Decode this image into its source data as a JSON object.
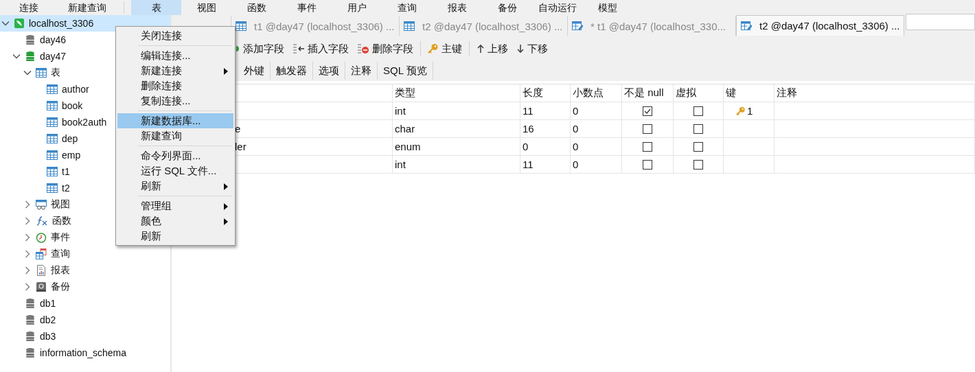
{
  "toolbar": [
    {
      "label": "连接",
      "selected": false
    },
    {
      "label": "新建查询",
      "selected": false
    },
    {
      "label": "表",
      "selected": true
    },
    {
      "label": "视图",
      "selected": false
    },
    {
      "label": "函数",
      "selected": false
    },
    {
      "label": "事件",
      "selected": false
    },
    {
      "label": "用户",
      "selected": false
    },
    {
      "label": "查询",
      "selected": false
    },
    {
      "label": "报表",
      "selected": false
    },
    {
      "label": "备份",
      "selected": false
    },
    {
      "label": "自动运行",
      "selected": false
    },
    {
      "label": "模型",
      "selected": false
    }
  ],
  "tree": [
    {
      "label": "localhost_3306",
      "kind": "connection",
      "expanded": true,
      "selected": true,
      "children": [
        {
          "label": "day46",
          "kind": "database",
          "open": false,
          "selected": false
        },
        {
          "label": "day47",
          "kind": "database",
          "open": true,
          "expanded": true,
          "selected": false,
          "children": [
            {
              "label": "表",
              "kind": "tables",
              "expanded": true,
              "selected": false,
              "children": [
                {
                  "label": "author",
                  "kind": "table",
                  "selected": false
                },
                {
                  "label": "book",
                  "kind": "table",
                  "selected": false
                },
                {
                  "label": "book2auth",
                  "kind": "table",
                  "selected": false
                },
                {
                  "label": "dep",
                  "kind": "table",
                  "selected": false
                },
                {
                  "label": "emp",
                  "kind": "table",
                  "selected": false
                },
                {
                  "label": "t1",
                  "kind": "table",
                  "selected": false
                },
                {
                  "label": "t2",
                  "kind": "table",
                  "selected": false
                }
              ]
            },
            {
              "label": "视图",
              "kind": "views",
              "expanded": false,
              "selected": false
            },
            {
              "label": "函数",
              "kind": "functions",
              "expanded": false,
              "selected": false
            },
            {
              "label": "事件",
              "kind": "events",
              "expanded": false,
              "selected": false
            },
            {
              "label": "查询",
              "kind": "queries",
              "expanded": false,
              "selected": false
            },
            {
              "label": "报表",
              "kind": "reports",
              "expanded": false,
              "selected": false
            },
            {
              "label": "备份",
              "kind": "backups",
              "expanded": false,
              "selected": false
            }
          ]
        },
        {
          "label": "db1",
          "kind": "database",
          "open": false,
          "selected": false
        },
        {
          "label": "db2",
          "kind": "database",
          "open": false,
          "selected": false
        },
        {
          "label": "db3",
          "kind": "database",
          "open": false,
          "selected": false
        },
        {
          "label": "information_schema",
          "kind": "database",
          "open": false,
          "selected": false
        }
      ]
    }
  ],
  "tabs": [
    {
      "kind": "objects",
      "selected": false
    },
    {
      "kind": "table",
      "label": "t1 @day47 (localhost_3306) ...",
      "selected": false
    },
    {
      "kind": "table",
      "label": "t2 @day47 (localhost_3306) ...",
      "selected": false
    },
    {
      "kind": "design",
      "label": "* t1 @day47 (localhost_330...",
      "selected": false
    },
    {
      "kind": "design",
      "label": "t2 @day47 (localhost_3306) ...",
      "selected": true
    }
  ],
  "design_toolbar": [
    {
      "kind": "add",
      "label": "添加字段"
    },
    {
      "kind": "insert",
      "label": "插入字段"
    },
    {
      "kind": "delete",
      "label": "删除字段"
    },
    {
      "kind": "key",
      "label": "主键"
    },
    {
      "kind": "up",
      "label": "上移"
    },
    {
      "kind": "down",
      "label": "下移"
    }
  ],
  "subtabs": [
    {
      "label": "外键",
      "selected": false
    },
    {
      "label": "触发器",
      "selected": false
    },
    {
      "label": "选项",
      "selected": false
    },
    {
      "label": "注释",
      "selected": false
    },
    {
      "label": "SQL 预览",
      "selected": false
    }
  ],
  "table": {
    "columns": [
      "类型",
      "长度",
      "小数点",
      "不是 null",
      "虚拟",
      "键",
      "注释"
    ],
    "rows": [
      {
        "type": "int",
        "length": "11",
        "decimals": "0",
        "not_null": true,
        "virtual": false,
        "key": "1"
      },
      {
        "name": "e",
        "type": "char",
        "length": "16",
        "decimals": "0",
        "not_null": false,
        "virtual": false
      },
      {
        "name": "ler",
        "type": "enum",
        "length": "0",
        "decimals": "0",
        "not_null": false,
        "virtual": false
      },
      {
        "type": "int",
        "length": "11",
        "decimals": "0",
        "not_null": false,
        "virtual": false
      }
    ]
  },
  "context_menu": [
    {
      "label": "关闭连接",
      "submenu": false,
      "selected": false
    },
    {
      "kind": "separator"
    },
    {
      "label": "编辑连接...",
      "submenu": false,
      "selected": false
    },
    {
      "label": "新建连接",
      "submenu": true,
      "selected": false
    },
    {
      "label": "删除连接",
      "submenu": false,
      "selected": false
    },
    {
      "label": "复制连接...",
      "submenu": false,
      "selected": false
    },
    {
      "kind": "separator"
    },
    {
      "label": "新建数据库...",
      "submenu": false,
      "selected": true
    },
    {
      "label": "新建查询",
      "submenu": false,
      "selected": false
    },
    {
      "kind": "separator"
    },
    {
      "label": "命令列界面...",
      "submenu": false,
      "selected": false
    },
    {
      "label": "运行 SQL 文件...",
      "submenu": false,
      "selected": false
    },
    {
      "label": "刷新",
      "submenu": true,
      "selected": false
    },
    {
      "kind": "separator"
    },
    {
      "label": "管理组",
      "submenu": true,
      "selected": false
    },
    {
      "label": "颜色",
      "submenu": true,
      "selected": false
    },
    {
      "label": "刷新",
      "submenu": false,
      "selected": false
    }
  ]
}
